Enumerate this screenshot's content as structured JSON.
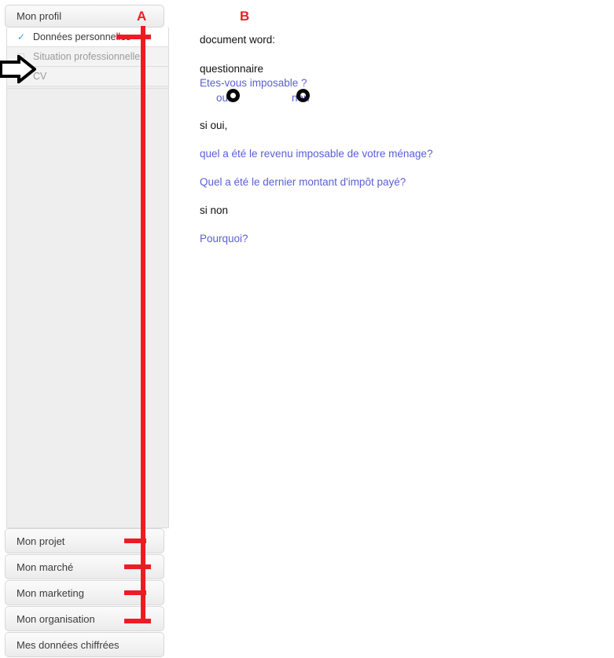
{
  "sidebar": {
    "header": {
      "title": "Mon profil"
    },
    "sub_items": [
      {
        "label": "Données personnelles",
        "checked": true,
        "selected": true
      },
      {
        "label": "Situation professionnelle",
        "checked": false,
        "selected": false
      },
      {
        "label": "CV",
        "checked": true,
        "selected": false
      }
    ],
    "menu_items": [
      {
        "label": "Mon projet"
      },
      {
        "label": "Mon marché"
      },
      {
        "label": "Mon marketing"
      },
      {
        "label": "Mon organisation"
      },
      {
        "label": "Mes données chiffrées"
      }
    ]
  },
  "content": {
    "doc_label": "document word:",
    "questionnaire_label": "questionnaire",
    "question_main": "Etes-vous imposable ?",
    "option_yes": "oui",
    "option_no": "non",
    "if_yes": "si oui,",
    "question_income": "quel a été le revenu imposable de votre ménage?",
    "question_tax": "Quel a été le dernier montant d'impôt payé?",
    "if_no": "si non",
    "question_why": "Pourquoi?"
  },
  "annotations": {
    "label_a": "A",
    "label_b": "B",
    "color_red": "#ed1c24",
    "color_black": "#0a0a0a"
  },
  "colors": {
    "link_blue": "#5a5fd4",
    "check_blue": "#3f9fe0",
    "text_dark": "#3b3b3b",
    "text_muted": "#9b9b9b"
  }
}
